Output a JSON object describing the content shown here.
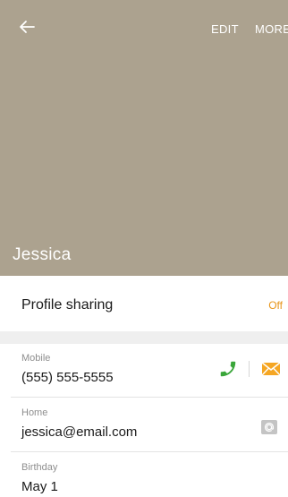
{
  "header": {
    "edit_label": "EDIT",
    "more_label": "MORE",
    "contact_name": "Jessica",
    "background_color": "#aca28f"
  },
  "profile_sharing": {
    "label": "Profile sharing",
    "value": "Off",
    "value_color": "#e8961c"
  },
  "fields": {
    "mobile": {
      "label": "Mobile",
      "value": "(555) 555-5555"
    },
    "home": {
      "label": "Home",
      "value": "jessica@email.com"
    },
    "birthday": {
      "label": "Birthday",
      "value": "May 1"
    }
  },
  "icons": {
    "back": "arrow-left-icon",
    "call": "phone-icon",
    "message": "envelope-icon",
    "email": "at-sign-icon"
  },
  "colors": {
    "call_icon": "#3aa63a",
    "message_icon": "#f5a623",
    "email_icon": "#9e9e9e"
  }
}
